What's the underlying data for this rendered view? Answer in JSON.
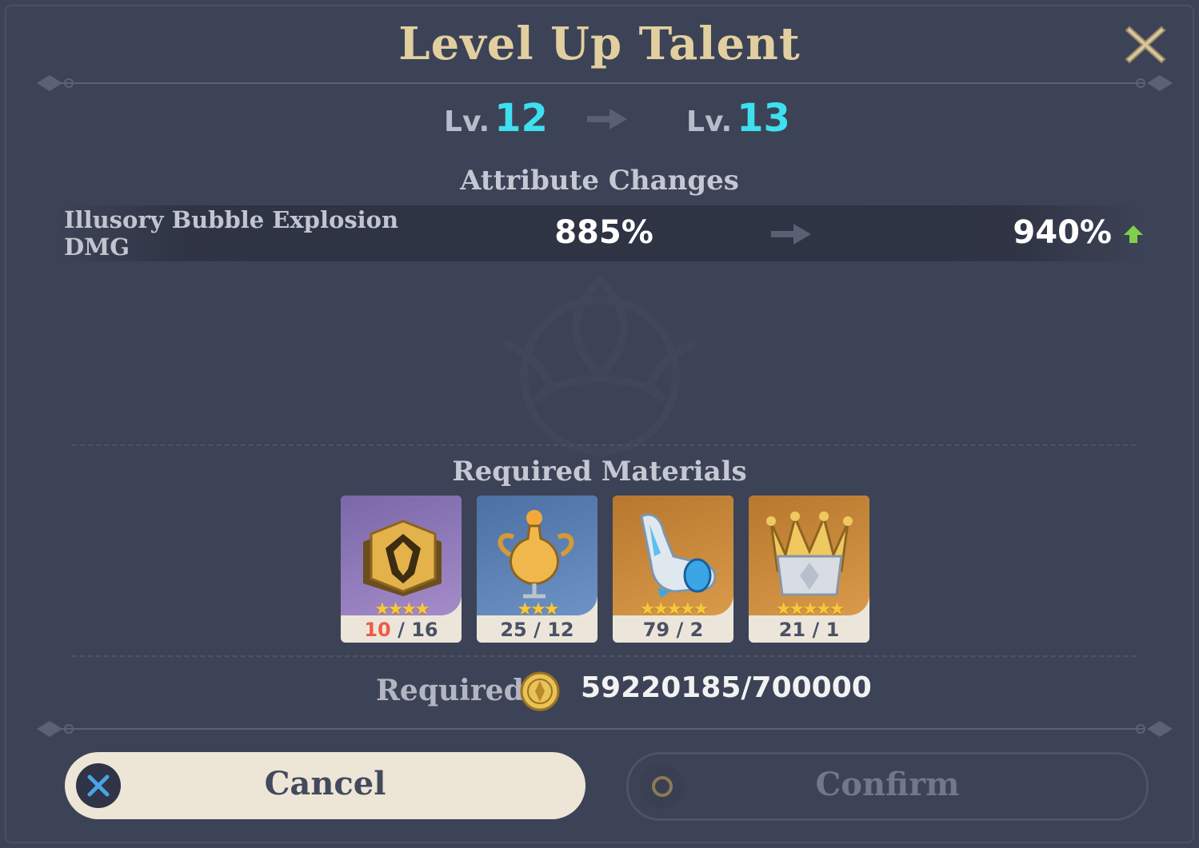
{
  "dialog": {
    "title": "Level Up Talent",
    "level": {
      "prefix": "Lv.",
      "current": "12",
      "next": "13"
    },
    "attribute_section_title": "Attribute Changes",
    "attribute": {
      "name": "Illusory Bubble Explosion DMG",
      "old_value": "885%",
      "new_value": "940%"
    },
    "materials_section_title": "Required Materials",
    "materials": [
      {
        "icon": "talent-book-icon",
        "stars": "★★★★",
        "owned": "10",
        "required": "/ 16",
        "insufficient": true
      },
      {
        "icon": "nectar-vial-icon",
        "stars": "★★★",
        "owned": "25 / 12",
        "required": "",
        "insufficient": false
      },
      {
        "icon": "crystal-slipper-icon",
        "stars": "★★★★★",
        "owned": "79 / 2",
        "required": "",
        "insufficient": false
      },
      {
        "icon": "crown-of-insight-icon",
        "stars": "★★★★★",
        "owned": "21 / 1",
        "required": "",
        "insufficient": false
      }
    ],
    "mora": {
      "label": "Required",
      "icon": "mora-coin-icon",
      "value": "59220185/700000"
    },
    "buttons": {
      "cancel": "Cancel",
      "confirm": "Confirm"
    }
  },
  "colors": {
    "background": "#3d4356",
    "title_gold": "#e2cfa0",
    "level_cyan": "#3ee0f0",
    "increase_green": "#7fd04a",
    "insufficient_red": "#ee5a47",
    "cancel_button_bg": "#ede5d6"
  }
}
